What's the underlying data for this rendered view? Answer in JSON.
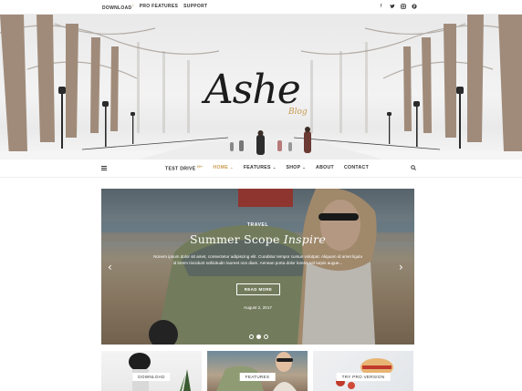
{
  "topbar": {
    "links": [
      {
        "label": "DOWNLOAD",
        "sup": "i"
      },
      {
        "label": "PRO FEATURES",
        "sup": ""
      },
      {
        "label": "SUPPORT",
        "sup": ""
      }
    ],
    "social_icons": [
      "facebook-icon",
      "twitter-icon",
      "instagram-icon",
      "pinterest-icon"
    ]
  },
  "header": {
    "logo_text": "Ashe",
    "logo_sub": "Blog"
  },
  "nav": {
    "items": [
      {
        "label": "TEST DRIVE",
        "sup": "99+",
        "caret": false,
        "active": false
      },
      {
        "label": "HOME",
        "sup": "",
        "caret": true,
        "active": true
      },
      {
        "label": "FEATURES",
        "sup": "",
        "caret": true,
        "active": false
      },
      {
        "label": "SHOP",
        "sup": "",
        "caret": true,
        "active": false
      },
      {
        "label": "ABOUT",
        "sup": "",
        "caret": false,
        "active": false
      },
      {
        "label": "CONTACT",
        "sup": "",
        "caret": false,
        "active": false
      }
    ]
  },
  "slider": {
    "category": "TRAVEL",
    "title_plain": "Summer Scope",
    "title_italic": "Inspire",
    "excerpt": "Nonem ipsum dolor sit amet, consectetur adipiscing elit. Curabitur tempor cursus volutpat. Aliquam id amet ligula id lorem tincidunt sollicitudin laoreet non diam. Aenean porta dolor lorem, vel turpis augue...",
    "button": "READ MORE",
    "date": "August 2, 2017",
    "slide_count": 3,
    "active_slide": 2
  },
  "promos": [
    {
      "label": "DOWNLOAD"
    },
    {
      "label": "FEATURES"
    },
    {
      "label": "TRY PRO VERSION"
    }
  ],
  "colors": {
    "accent": "#ca9b52",
    "text": "#333333"
  }
}
